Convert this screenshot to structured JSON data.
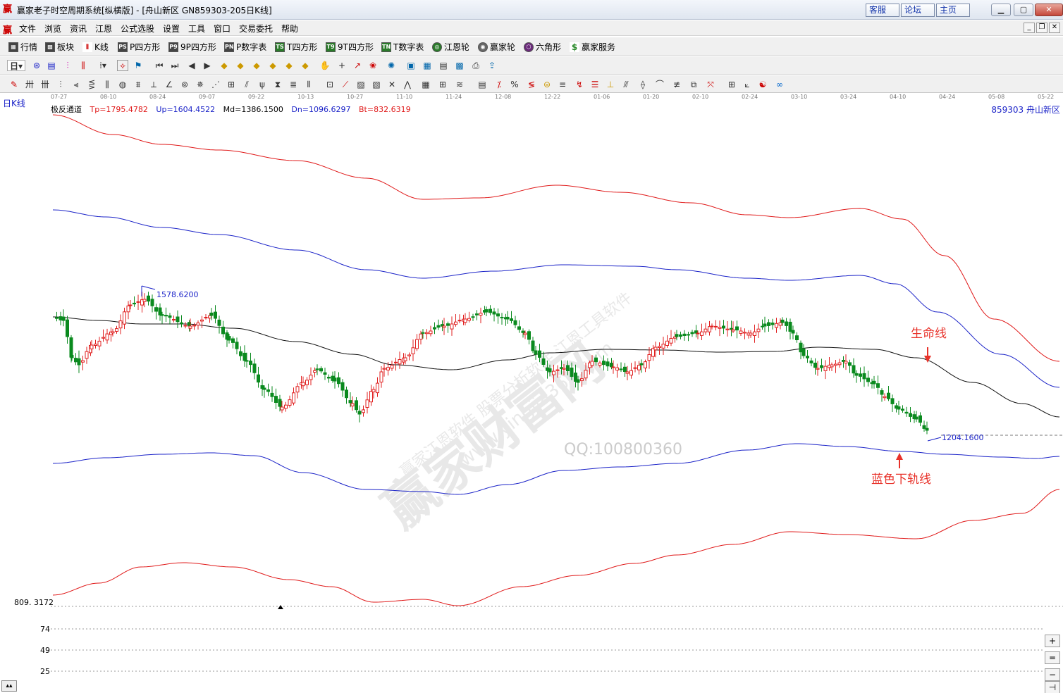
{
  "window": {
    "title": "赢家老子时空周期系统[纵横版] - [舟山新区   GN859303-205日K线]",
    "links": [
      "客服",
      "论坛",
      "主页"
    ]
  },
  "menu": {
    "items": [
      "文件",
      "浏览",
      "资讯",
      "江恩",
      "公式选股",
      "设置",
      "工具",
      "窗口",
      "交易委托",
      "帮助"
    ]
  },
  "toolbar": {
    "items": [
      "行情",
      "板块",
      "K线",
      "P四方形",
      "9P四方形",
      "P数字表",
      "T四方形",
      "9T四方形",
      "T数字表",
      "江恩轮",
      "赢家轮",
      "六角形",
      "赢家服务"
    ],
    "period": "日"
  },
  "chart": {
    "period_label": "日K线",
    "indicator_name": "极反通道",
    "tp": "Tp=1795.4782",
    "up": "Up=1604.4522",
    "md": "Md=1386.1500",
    "dn": "Dn=1096.6297",
    "bt": "Bt=832.6319",
    "code_name": "859303  舟山新区",
    "high_price": "1578.6200",
    "low_price": "1204.1600",
    "axis_low": "809. 3172",
    "annotation_life": "生命线",
    "annotation_lower": "蓝色下轨线",
    "watermark_main": "赢家财富网",
    "watermark_sub1": "赢家江恩软件 股票分析软件 江恩工具软件",
    "watermark_sub2": "www.yingjia360.com",
    "watermark_qq": "QQ:100800360",
    "dates": [
      "07-27",
      "08-10",
      "08-24",
      "09-07",
      "09-22",
      "10-13",
      "10-27",
      "11-10",
      "11-24",
      "12-08",
      "12-22",
      "01-06",
      "01-20",
      "02-10",
      "02-24",
      "03-10",
      "03-24",
      "04-10",
      "04-24",
      "05-08",
      "05-22"
    ],
    "sub_levels": [
      "74",
      "49",
      "25"
    ]
  },
  "colors": {
    "red_band": "#e01a1a",
    "blue_band": "#1b23c8",
    "mid_line": "#111111",
    "candle_up": "#e02020",
    "candle_down": "#0a8a1e"
  }
}
